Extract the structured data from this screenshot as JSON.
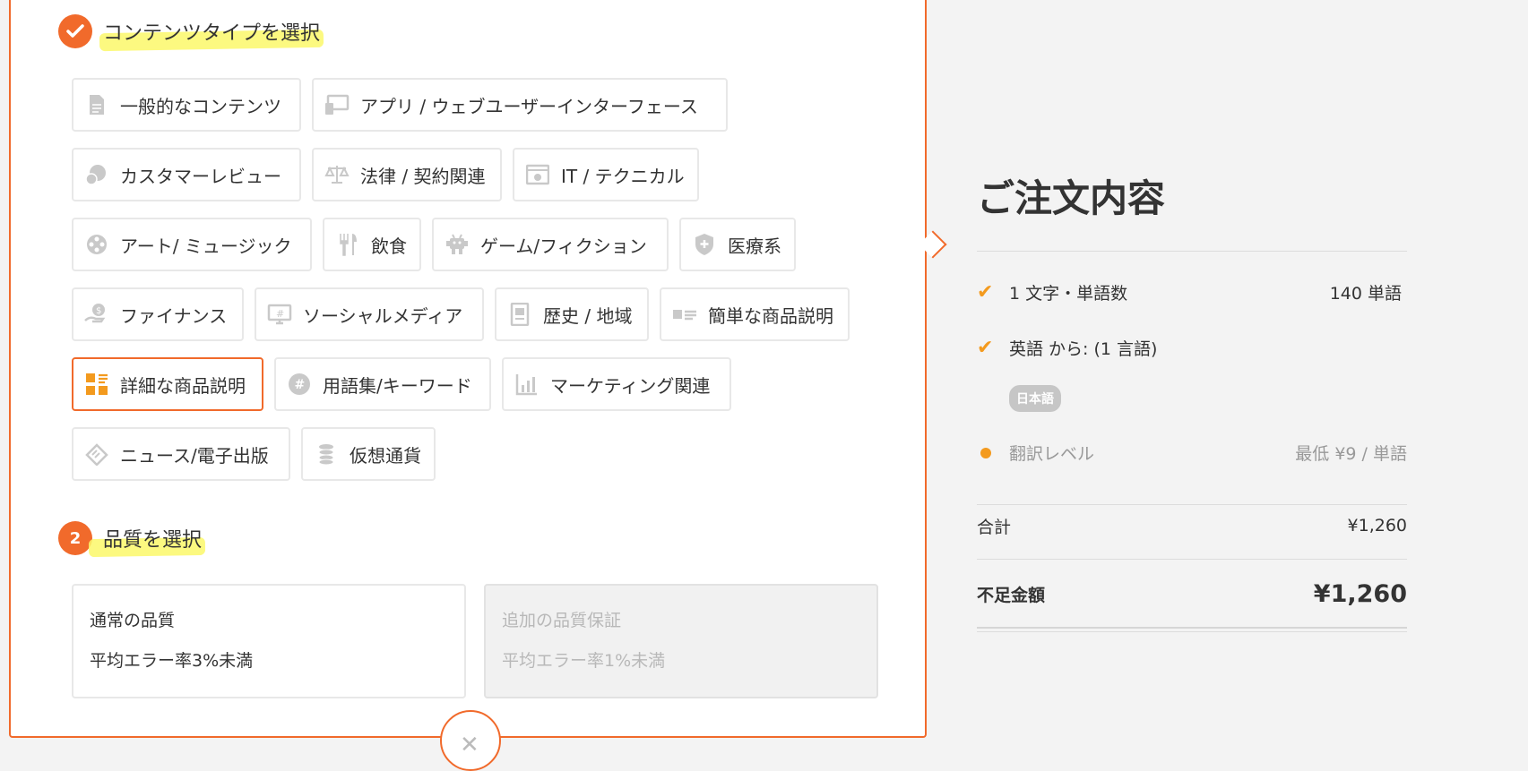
{
  "step1": {
    "title": "コンテンツタイプを選択"
  },
  "content_types": [
    {
      "label": "一般的なコンテンツ",
      "icon": "document-icon",
      "selected": false
    },
    {
      "label": "アプリ / ウェブユーザーインターフェース",
      "icon": "devices-icon",
      "selected": false
    },
    {
      "label": "カスタマーレビュー",
      "icon": "chat-bubble-icon",
      "selected": false
    },
    {
      "label": "法律 / 契約関連",
      "icon": "scales-icon",
      "selected": false
    },
    {
      "label": "IT / テクニカル",
      "icon": "browser-gear-icon",
      "selected": false
    },
    {
      "label": "アート/ ミュージック",
      "icon": "film-reel-icon",
      "selected": false
    },
    {
      "label": "飲食",
      "icon": "utensils-icon",
      "selected": false
    },
    {
      "label": "ゲーム/フィクション",
      "icon": "game-character-icon",
      "selected": false
    },
    {
      "label": "医療系",
      "icon": "medical-shield-icon",
      "selected": false
    },
    {
      "label": "ファイナンス",
      "icon": "money-hand-icon",
      "selected": false
    },
    {
      "label": "ソーシャルメディア",
      "icon": "social-screen-icon",
      "selected": false
    },
    {
      "label": "歴史 / 地域",
      "icon": "book-icon",
      "selected": false
    },
    {
      "label": "簡単な商品説明",
      "icon": "product-list-icon",
      "selected": false
    },
    {
      "label": "詳細な商品説明",
      "icon": "product-grid-icon",
      "selected": true
    },
    {
      "label": "用語集/キーワード",
      "icon": "hashtag-icon",
      "selected": false
    },
    {
      "label": "マーケティング関連",
      "icon": "bar-chart-icon",
      "selected": false
    },
    {
      "label": "ニュース/電子出版",
      "icon": "newspaper-icon",
      "selected": false
    },
    {
      "label": "仮想通貨",
      "icon": "coin-stack-icon",
      "selected": false
    }
  ],
  "step2": {
    "number": "2",
    "title": "品質を選択"
  },
  "quality": [
    {
      "name": "通常の品質",
      "detail": "平均エラー率3%未満",
      "disabled": false
    },
    {
      "name": "追加の品質保証",
      "detail": "平均エラー率1%未満",
      "disabled": true
    }
  ],
  "summary": {
    "title": "ご注文内容",
    "words_label": "1 文字・単語数",
    "words_value": "140 単語",
    "lang_label": "英語 から: (1 言語)",
    "lang_badge": "日本語",
    "level_label": "翻訳レベル",
    "level_value": "最低 ¥9 / 単語",
    "total_label": "合計",
    "total_value": "¥1,260",
    "due_label": "不足金額",
    "due_value": "¥1,260"
  },
  "colors": {
    "accent": "#f16a2b",
    "check": "#f39a1e",
    "highlight": "#fbf86a"
  }
}
